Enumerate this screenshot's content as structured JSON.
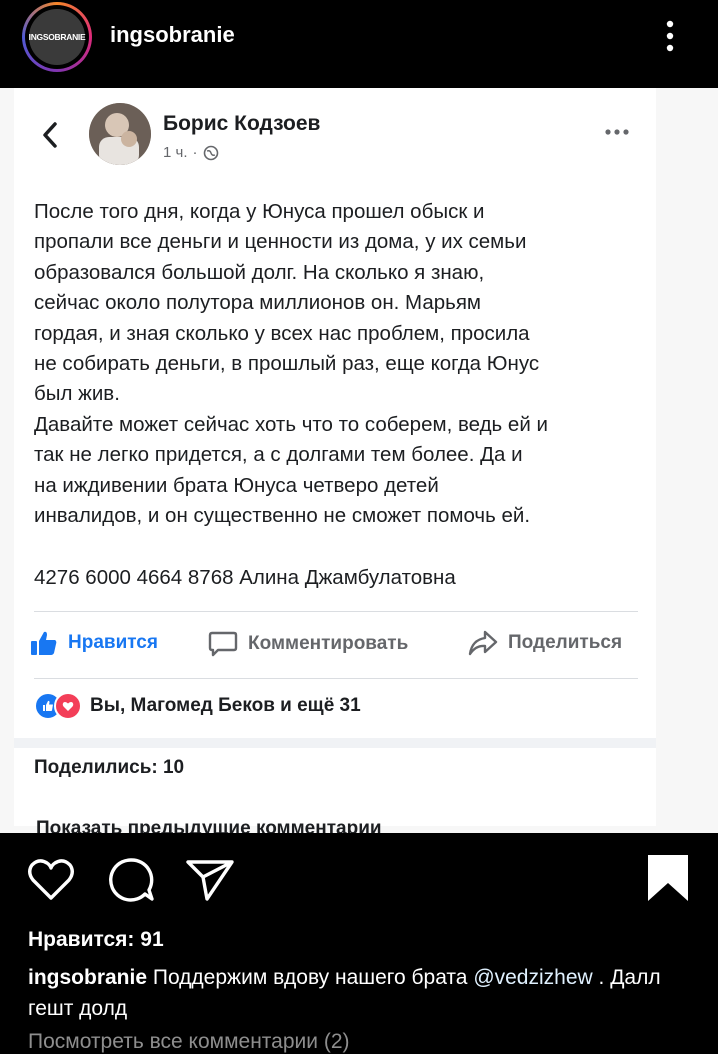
{
  "header": {
    "avatar_text": "INGSOBRANIE",
    "username": "ingsobranie",
    "more_icon": "more-vertical-icon"
  },
  "post": {
    "author": "Борис Кодзоев",
    "time": "1 ч.",
    "meta_sep": "·",
    "text": "После того дня, когда у Юнуса прошел обыск и\nпропали все деньги и ценности из дома, у их семьи\nобразовался большой долг. На сколько я знаю,\nсейчас около полутора миллионов он. Марьям\nгордая, и зная сколько у всех нас проблем, просила\nне собирать деньги, в прошлый раз, еще когда Юнус\nбыл жив.\nДавайте может сейчас хоть что то соберем, ведь ей и\nтак не легко придется, а с долгами тем более. Да и\nна иждивении брата Юнуса четверо детей\nинвалидов, и он существенно не сможет помочь ей.",
    "card": "4276 6000 4664 8768 Алина Джамбулатовна",
    "actions": {
      "like": "Нравится",
      "comment": "Комментировать",
      "share": "Поделиться"
    },
    "reactions": "Вы, Магомед Беков и ещё 31",
    "shares": "Поделились: 10",
    "prev_comments": "Показать предыдущие комментарии",
    "colors": {
      "like_blue": "#1877f2",
      "love_red": "#f33e58"
    }
  },
  "footer": {
    "likes": "Нравится: 91",
    "caption_user": "ingsobranie",
    "caption_text": " Поддержим вдову нашего брата ",
    "caption_mention": "@vedzizhew",
    "caption_end": " . Далл гешт долд",
    "view_all": "Посмотреть все комментарии (2)"
  }
}
